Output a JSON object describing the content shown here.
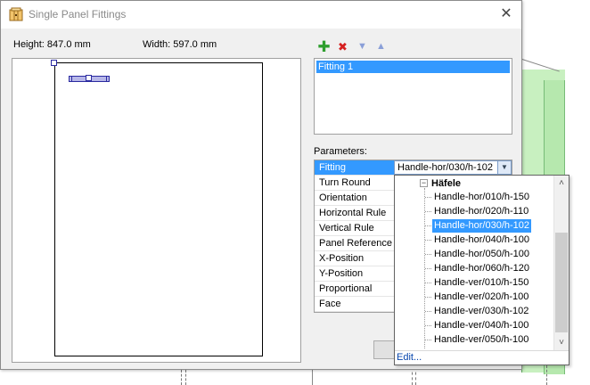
{
  "window": {
    "title": "Single Panel Fittings",
    "close_glyph": "✕"
  },
  "dimensions": {
    "height_label": "Height: 847.0 mm",
    "width_label": "Width: 597.0 mm"
  },
  "toolbar": {
    "add_glyph": "✚",
    "delete_glyph": "✖",
    "down_glyph": "▼",
    "up_glyph": "▲"
  },
  "fittings": {
    "items": [
      {
        "label": "Fitting 1"
      }
    ]
  },
  "parameters": {
    "label": "Parameters:",
    "rows": [
      {
        "name": "Fitting"
      },
      {
        "name": "Turn Round"
      },
      {
        "name": "Orientation"
      },
      {
        "name": "Horizontal Rule"
      },
      {
        "name": "Vertical Rule"
      },
      {
        "name": "Panel Reference"
      },
      {
        "name": "X-Position"
      },
      {
        "name": "Y-Position"
      },
      {
        "name": "Proportional"
      },
      {
        "name": "Face"
      }
    ],
    "fitting_value": "Handle-hor/030/h-102",
    "combo_arrow": "▼"
  },
  "dropdown": {
    "expander_glyph": "−",
    "group": "Häfele",
    "items": [
      {
        "label": "Handle-hor/010/h-150"
      },
      {
        "label": "Handle-hor/020/h-110"
      },
      {
        "label": "Handle-hor/030/h-102"
      },
      {
        "label": "Handle-hor/040/h-100"
      },
      {
        "label": "Handle-hor/050/h-100"
      },
      {
        "label": "Handle-hor/060/h-120"
      },
      {
        "label": "Handle-ver/010/h-150"
      },
      {
        "label": "Handle-ver/020/h-100"
      },
      {
        "label": "Handle-ver/030/h-102"
      },
      {
        "label": "Handle-ver/040/h-100"
      },
      {
        "label": "Handle-ver/050/h-100"
      }
    ],
    "selected_index": 2,
    "edit_label": "Edit...",
    "scroll_up_glyph": "˄",
    "scroll_down_glyph": "˅"
  },
  "colors": {
    "selection": "#3399ff",
    "panel_green": "#c8f0c0",
    "link": "#0645ad"
  }
}
